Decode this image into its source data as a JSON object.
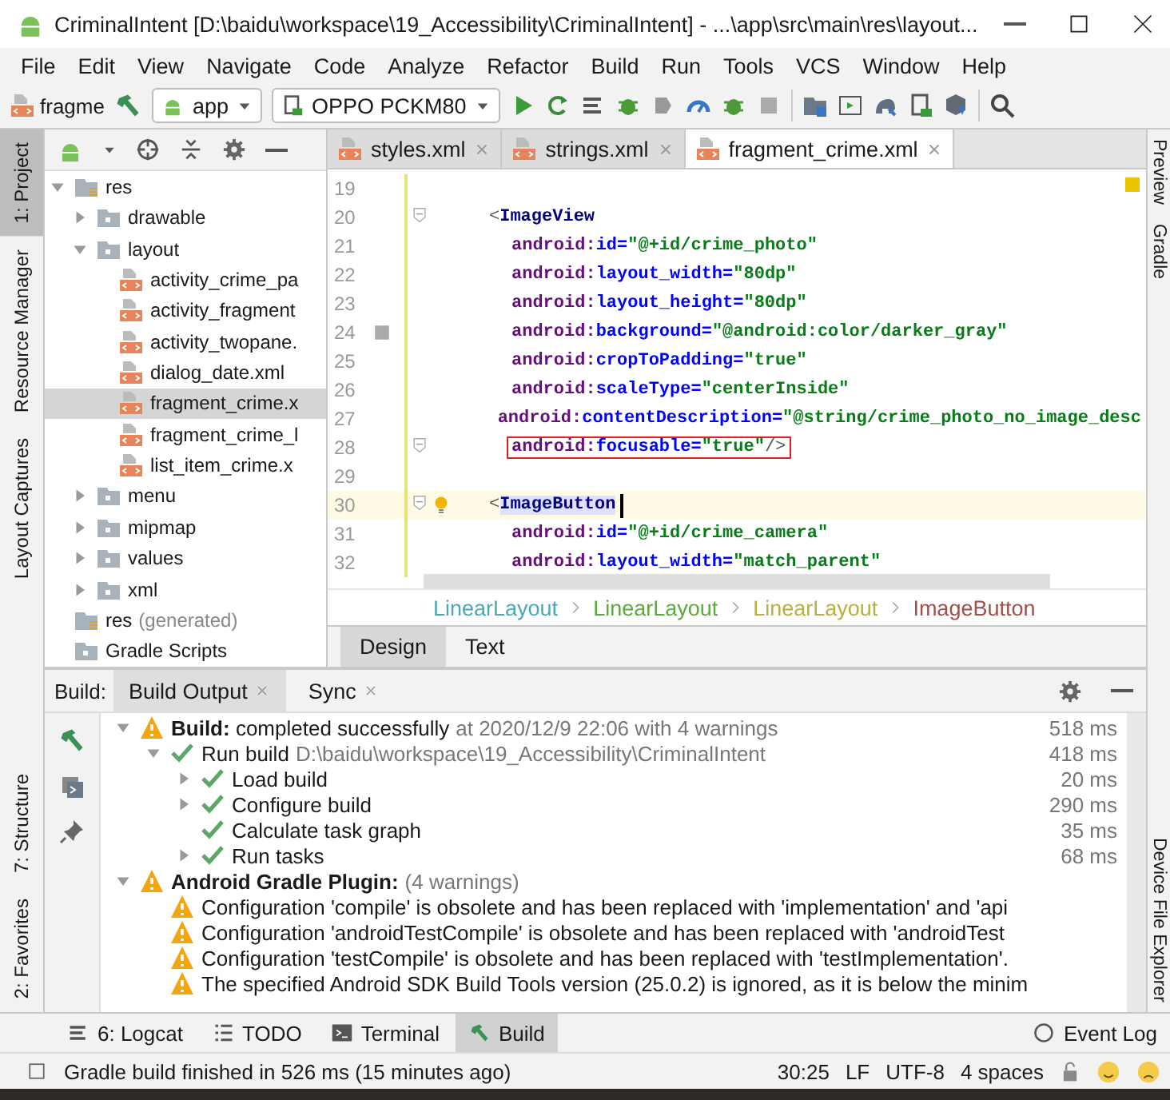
{
  "window": {
    "title": "CriminalIntent [D:\\baidu\\workspace\\19_Accessibility\\CriminalIntent] - ...\\app\\src\\main\\res\\layout..."
  },
  "menubar": [
    "File",
    "Edit",
    "View",
    "Navigate",
    "Code",
    "Analyze",
    "Refactor",
    "Build",
    "Run",
    "Tools",
    "VCS",
    "Window",
    "Help"
  ],
  "toolbar": {
    "file_crumb": "fragme",
    "config": "app",
    "device": "OPPO PCKM80"
  },
  "left_stripe": [
    {
      "label": "1: Project",
      "selected": true
    },
    {
      "label": "Resource Manager",
      "selected": false
    },
    {
      "label": "Layout Captures",
      "selected": false
    }
  ],
  "left_stripe_bottom": [
    {
      "label": "7: Structure",
      "selected": false
    },
    {
      "label": "2: Favorites",
      "selected": false
    }
  ],
  "right_stripe": [
    {
      "label": "Preview"
    },
    {
      "label": "Gradle"
    },
    {
      "label": "Device File Explorer"
    }
  ],
  "project_tree": [
    {
      "label": "res",
      "kind": "res",
      "expanded": true,
      "children": [
        {
          "label": "drawable",
          "kind": "folder",
          "expanded": false
        },
        {
          "label": "layout",
          "kind": "folder",
          "expanded": true,
          "children": [
            {
              "label": "activity_crime_pa",
              "kind": "file",
              "selected": false
            },
            {
              "label": "activity_fragment",
              "kind": "file",
              "selected": false
            },
            {
              "label": "activity_twopane.",
              "kind": "file",
              "selected": false
            },
            {
              "label": "dialog_date.xml",
              "kind": "file",
              "selected": false
            },
            {
              "label": "fragment_crime.x",
              "kind": "file",
              "selected": true
            },
            {
              "label": "fragment_crime_l",
              "kind": "file",
              "selected": false
            },
            {
              "label": "list_item_crime.x",
              "kind": "file",
              "selected": false
            }
          ]
        },
        {
          "label": "menu",
          "kind": "folder",
          "expanded": false
        },
        {
          "label": "mipmap",
          "kind": "folder",
          "expanded": false
        },
        {
          "label": "values",
          "kind": "folder",
          "expanded": false
        },
        {
          "label": "xml",
          "kind": "folder",
          "expanded": false
        }
      ]
    },
    {
      "label": "res",
      "detail": "(generated)",
      "kind": "res"
    },
    {
      "label": "Gradle Scripts",
      "kind": "gradle"
    }
  ],
  "editor_tabs": [
    {
      "label": "styles.xml",
      "selected": false
    },
    {
      "label": "strings.xml",
      "selected": false
    },
    {
      "label": "fragment_crime.xml",
      "selected": true
    }
  ],
  "code_lines": [
    {
      "num": "19",
      "kind": "blank",
      "fold": false,
      "current": false,
      "highlighted": false
    },
    {
      "num": "20",
      "kind": "element",
      "fold": true,
      "current": false,
      "highlighted": false,
      "tokens": [
        {
          "kind": "bracket",
          "text": "<"
        },
        {
          "kind": "tag",
          "text": "ImageView"
        }
      ]
    },
    {
      "num": "21",
      "kind": "attribute",
      "fold": false,
      "current": false,
      "highlighted": false,
      "tokens": [
        {
          "kind": "ns",
          "text": "android:"
        },
        {
          "kind": "attr",
          "text": "id="
        },
        {
          "kind": "value",
          "text": "\"@+id/crime_photo\""
        }
      ]
    },
    {
      "num": "22",
      "kind": "attribute",
      "fold": false,
      "current": false,
      "highlighted": false,
      "tokens": [
        {
          "kind": "ns",
          "text": "android:"
        },
        {
          "kind": "attr",
          "text": "layout_width="
        },
        {
          "kind": "value",
          "text": "\"80dp\""
        }
      ]
    },
    {
      "num": "23",
      "kind": "attribute",
      "fold": false,
      "current": false,
      "highlighted": false,
      "tokens": [
        {
          "kind": "ns",
          "text": "android:"
        },
        {
          "kind": "attr",
          "text": "layout_height="
        },
        {
          "kind": "value",
          "text": "\"80dp\""
        }
      ]
    },
    {
      "num": "24",
      "kind": "attribute",
      "fold": false,
      "current": false,
      "highlighted": false,
      "tokens": [
        {
          "kind": "ns",
          "text": "android:"
        },
        {
          "kind": "attr",
          "text": "background="
        },
        {
          "kind": "color",
          "text": "\"@android:color/darker_gray\""
        }
      ]
    },
    {
      "num": "25",
      "kind": "attribute",
      "fold": false,
      "current": false,
      "highlighted": false,
      "tokens": [
        {
          "kind": "ns",
          "text": "android:"
        },
        {
          "kind": "attr",
          "text": "cropToPadding="
        },
        {
          "kind": "value",
          "text": "\"true\""
        }
      ]
    },
    {
      "num": "26",
      "kind": "attribute",
      "fold": false,
      "current": false,
      "highlighted": false,
      "tokens": [
        {
          "kind": "ns",
          "text": "android:"
        },
        {
          "kind": "attr",
          "text": "scaleType="
        },
        {
          "kind": "value",
          "text": "\"centerInside\""
        }
      ]
    },
    {
      "num": "27",
      "kind": "attribute",
      "fold": false,
      "current": false,
      "highlighted": false,
      "tokens": [
        {
          "kind": "ns",
          "text": "android:"
        },
        {
          "kind": "attr",
          "text": "contentDescription="
        },
        {
          "kind": "value",
          "text": "\"@string/crime_photo_no_image_desc"
        }
      ]
    },
    {
      "num": "28",
      "kind": "attribute",
      "fold": true,
      "current": false,
      "highlighted": true,
      "tokens": [
        {
          "kind": "ns",
          "text": "android:"
        },
        {
          "kind": "attr",
          "text": "focusable="
        },
        {
          "kind": "value",
          "text": "\"true\""
        },
        {
          "kind": "bracket",
          "text": " />"
        }
      ]
    },
    {
      "num": "29",
      "kind": "blank",
      "fold": false,
      "current": false,
      "highlighted": false
    },
    {
      "num": "30",
      "kind": "element",
      "fold": true,
      "current": true,
      "highlighted": false,
      "tokens": [
        {
          "kind": "bracket",
          "text": "<"
        },
        {
          "kind": "tag",
          "text": "ImageButton"
        }
      ]
    },
    {
      "num": "31",
      "kind": "attribute",
      "fold": false,
      "current": false,
      "highlighted": false,
      "tokens": [
        {
          "kind": "ns",
          "text": "android:"
        },
        {
          "kind": "attr",
          "text": "id="
        },
        {
          "kind": "value",
          "text": "\"@+id/crime_camera\""
        }
      ]
    },
    {
      "num": "32",
      "kind": "attribute",
      "fold": false,
      "current": false,
      "highlighted": false,
      "tokens": [
        {
          "kind": "ns",
          "text": "android:"
        },
        {
          "kind": "attr",
          "text": "layout_width="
        },
        {
          "kind": "value",
          "text": "\"match_parent\""
        }
      ]
    }
  ],
  "breadcrumb": [
    {
      "label": "LinearLayout",
      "color": "#4aa8b8"
    },
    {
      "label": "LinearLayout",
      "color": "#5aaa3c"
    },
    {
      "label": "LinearLayout",
      "color": "#b8b040"
    },
    {
      "label": "ImageButton",
      "color": "#a0504a"
    }
  ],
  "view_tabs": [
    {
      "label": "Design",
      "selected": false
    },
    {
      "label": "Text",
      "selected": true
    }
  ],
  "build_panel": {
    "label": "Build:",
    "tabs": [
      {
        "label": "Build Output",
        "selected": true
      },
      {
        "label": "Sync",
        "selected": false
      }
    ],
    "tree": [
      {
        "kind": "warning",
        "text": "**Build:** completed successfully",
        "detail": "at 2020/12/9 22:06  with 4 warnings",
        "time": "518 ms",
        "expanded": true,
        "children": [
          {
            "kind": "success",
            "text": "Run build",
            "detail": "D:\\baidu\\workspace\\19_Accessibility\\CriminalIntent",
            "time": "418 ms",
            "expanded": true,
            "children": [
              {
                "kind": "success",
                "text": "Load build",
                "time": "20 ms",
                "expanded": false
              },
              {
                "kind": "success",
                "text": "Configure build",
                "time": "290 ms",
                "expanded": false
              },
              {
                "kind": "success",
                "text": "Calculate task graph",
                "time": "35 ms"
              },
              {
                "kind": "success",
                "text": "Run tasks",
                "time": "68 ms",
                "expanded": false
              }
            ]
          }
        ]
      },
      {
        "kind": "warning",
        "text": "**Android Gradle Plugin:**",
        "detail": "(4 warnings)",
        "expanded": true,
        "children": [
          {
            "kind": "warning",
            "text": "Configuration 'compile' is obsolete and has been replaced with 'implementation' and 'api"
          },
          {
            "kind": "warning",
            "text": "Configuration 'androidTestCompile' is obsolete and has been replaced with 'androidTest"
          },
          {
            "kind": "warning",
            "text": "Configuration 'testCompile' is obsolete and has been replaced with 'testImplementation'."
          },
          {
            "kind": "warning",
            "text": "The specified Android SDK Build Tools version (25.0.2) is ignored, as it is below the minim"
          }
        ]
      }
    ]
  },
  "bottom_tabs": [
    {
      "label": "6: Logcat",
      "selected": false
    },
    {
      "label": "TODO",
      "selected": false
    },
    {
      "label": "Terminal",
      "selected": false
    },
    {
      "label": "Build",
      "selected": true
    }
  ],
  "event_log": "Event Log",
  "status_bar": {
    "message": "Gradle build finished in 526 ms (15 minutes ago)",
    "position": "30:25",
    "line_ending": "LF",
    "encoding": "UTF-8",
    "indent": "4 spaces"
  }
}
